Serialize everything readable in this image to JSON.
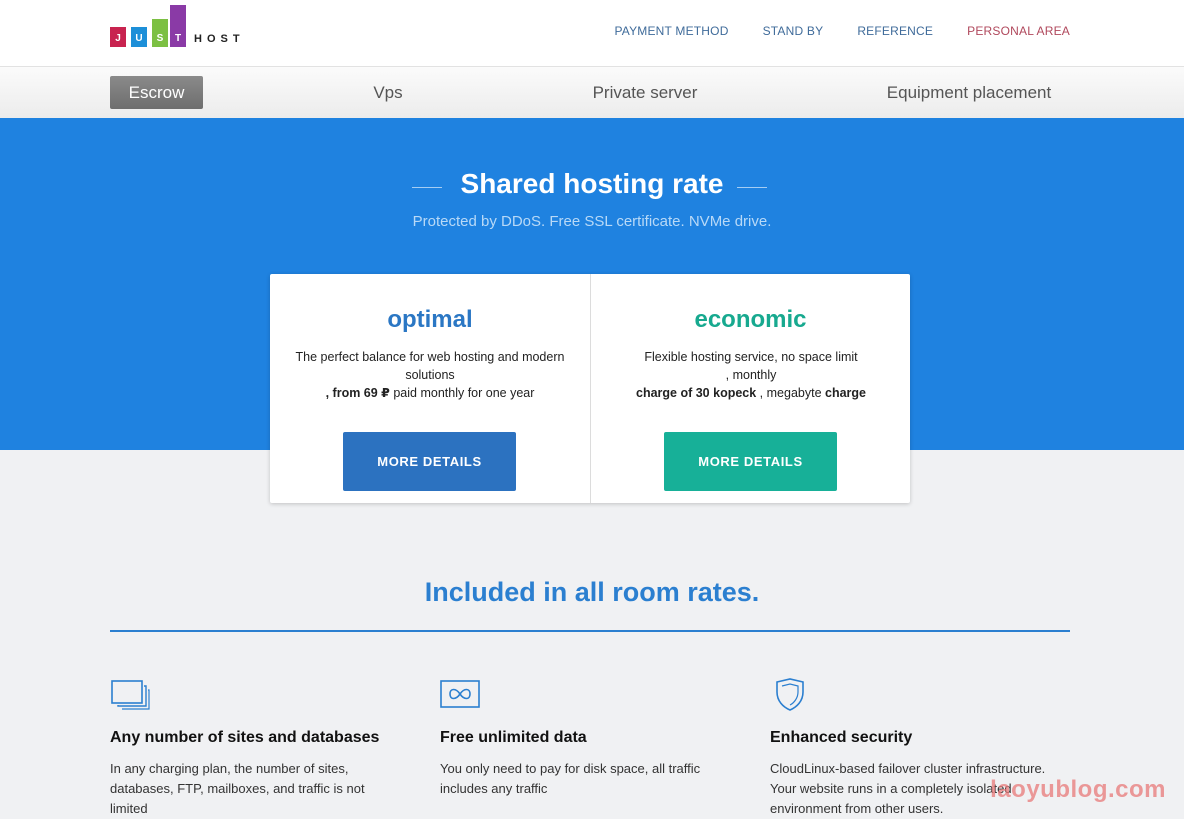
{
  "logo": {
    "letters": [
      "J",
      "U",
      "S",
      "T"
    ],
    "host": "HOST",
    "colors": [
      "#c8234f",
      "#1d8fd8",
      "#7cc043",
      "#8a3aa6"
    ]
  },
  "topnav": {
    "payment": "PAYMENT METHOD",
    "standby": "STAND BY",
    "reference": "REFERENCE",
    "personal": "PERSONAL AREA"
  },
  "subnav": {
    "escrow": "Escrow",
    "vps": "Vps",
    "private": "Private server",
    "equipment": "Equipment placement"
  },
  "hero": {
    "title": "Shared hosting rate",
    "subtitle": "Protected by DDoS. Free SSL certificate. NVMe drive."
  },
  "cards": {
    "optimal": {
      "title": "optimal",
      "line1": "The perfect balance for web hosting and modern solutions",
      "line2_bold": ", from 69 ₽",
      "line2_rest": " paid monthly for one year",
      "button": "MORE DETAILS"
    },
    "economic": {
      "title": "economic",
      "line1": "Flexible hosting service, no space limit",
      "line2": ", monthly",
      "line3_bold": "charge of 30 kopeck",
      "line3_mid": " , megabyte ",
      "line3_bold2": "charge",
      "button": "MORE DETAILS"
    }
  },
  "included": {
    "title": "Included in all room rates.",
    "features": [
      {
        "title": "Any number of sites and databases",
        "text": "In any charging plan, the number of sites, databases, FTP, mailboxes, and traffic is not limited"
      },
      {
        "title": "Free unlimited data",
        "text": "You only need to pay for disk space, all traffic includes any traffic"
      },
      {
        "title": "Enhanced security",
        "text": "CloudLinux-based failover cluster infrastructure. Your website runs in a completely isolated environment from other users."
      }
    ]
  },
  "watermark": "laoyublog.com"
}
